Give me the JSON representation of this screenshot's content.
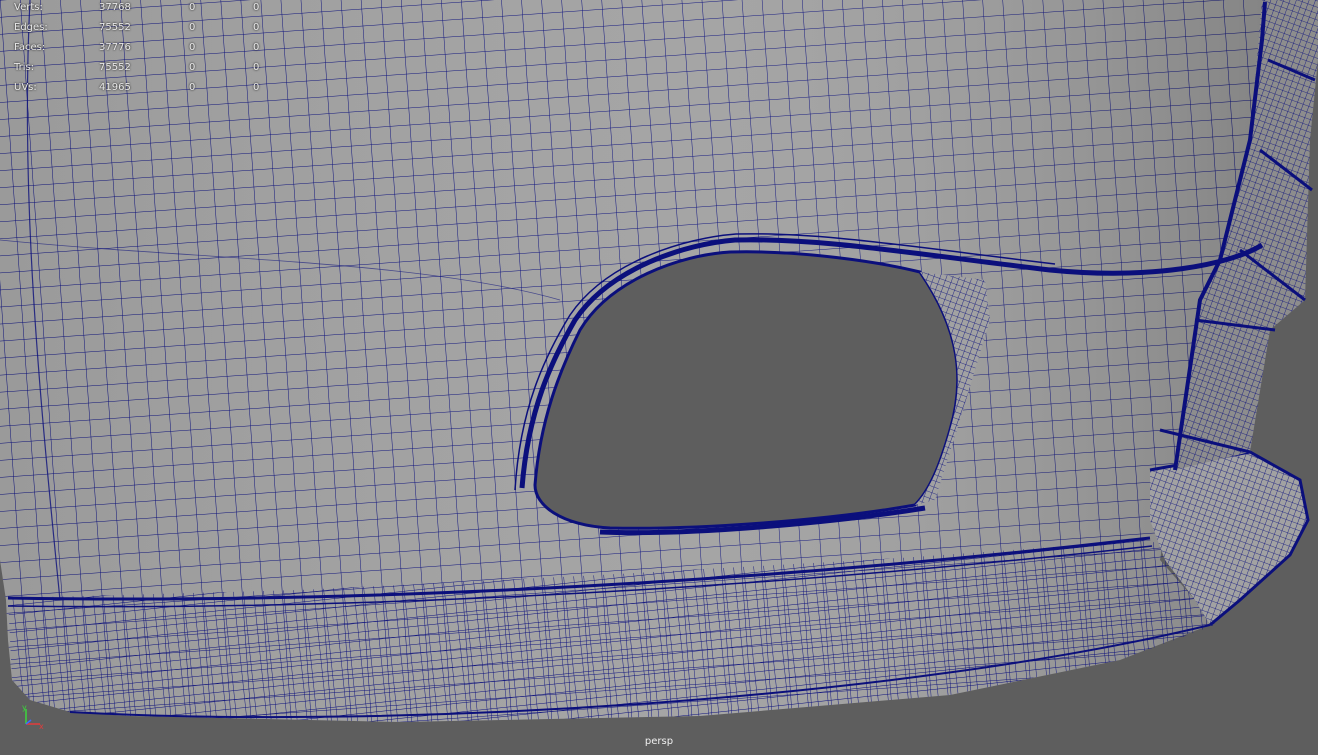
{
  "viewport": {
    "camera": "persp",
    "background_color": "#5e5e5e",
    "surface_color": "#a2a2a2",
    "wire_color": "#0b0f7c"
  },
  "hud": {
    "rows": [
      {
        "label": "Verts:",
        "total": "37768",
        "selected": "0",
        "component": "0"
      },
      {
        "label": "Edges:",
        "total": "75552",
        "selected": "0",
        "component": "0"
      },
      {
        "label": "Faces:",
        "total": "37776",
        "selected": "0",
        "component": "0"
      },
      {
        "label": "Tris:",
        "total": "75552",
        "selected": "0",
        "component": "0"
      },
      {
        "label": "UVs:",
        "total": "41965",
        "selected": "0",
        "component": "0"
      }
    ]
  },
  "axis": {
    "x_label": "x",
    "y_label": "y",
    "x_color": "#e23b3b",
    "y_color": "#3bd63b",
    "z_color": "#3b6bff"
  }
}
